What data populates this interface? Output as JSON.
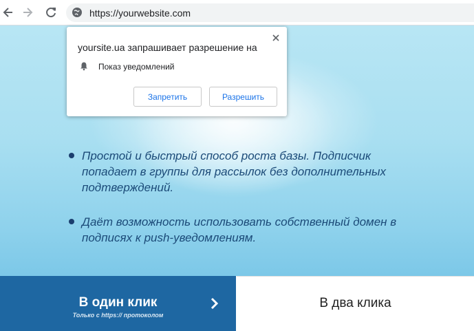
{
  "browser": {
    "url": "https://yourwebsite.com",
    "icons": [
      "back-arrow-icon",
      "forward-arrow-icon",
      "reload-icon",
      "globe-icon"
    ]
  },
  "popup": {
    "title": "yoursite.ua запрашивает разрешение на",
    "permission_label": "Показ уведомлений",
    "deny_label": "Запретить",
    "allow_label": "Разрешить",
    "icons": [
      "close-icon",
      "bell-icon"
    ]
  },
  "content": {
    "bullets": [
      "Простой и быстрый способ роста базы. Подписчик попадает в группы для рассылок без дополнительных подтверждений.",
      "Даёт возможность использовать собственный домен в подписях к push-уведомлениям."
    ]
  },
  "bottom": {
    "left_title": "В один клик",
    "left_subtitle": "Только с https:// протоколом",
    "right_title": "В два клика"
  },
  "colors": {
    "accent_blue": "#1e67a2",
    "link_blue": "#1a73e8",
    "text_dark_blue": "#1b4a78"
  }
}
